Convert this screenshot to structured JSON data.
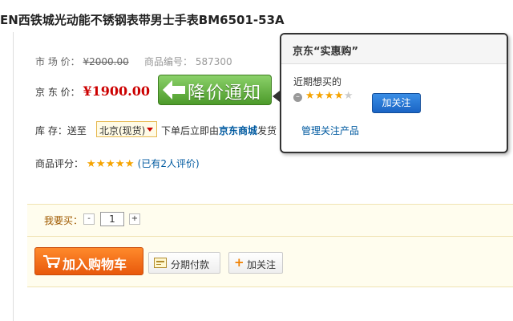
{
  "product": {
    "title": "EN西铁城光动能不锈钢表带男士手表BM6501-53A"
  },
  "market_price": {
    "label": "市 场 价：",
    "value": "¥2000.00"
  },
  "product_code": {
    "label": "商品编号：",
    "value": "587300"
  },
  "jd_price": {
    "label": "京 东 价：",
    "value": "¥1900.00"
  },
  "price_notify_button": "降价通知",
  "stock": {
    "label": "库    存：送至",
    "region": "北京(现货)",
    "note_prefix": "下单后立即由",
    "seller": "京东商城",
    "note_suffix": "发货"
  },
  "rating": {
    "label": "商品评分：",
    "stars": 5,
    "reviews_link": "(已有2人评价)"
  },
  "buy": {
    "want_label": "我要买：",
    "minus": "-",
    "quantity": "1",
    "plus": "+",
    "add_to_cart": "加入购物车",
    "installment": "分期付款",
    "follow": "加关注"
  },
  "popup": {
    "title": "京东“实惠购”",
    "recent_label": "近期想买的",
    "rating_stars": 4,
    "follow_button": "加关注",
    "manage_link": "管理关注产品"
  },
  "colors": {
    "price_red": "#cc0000",
    "link_blue": "#005aa0",
    "notify_green": "#4c9a2a",
    "cart_orange": "#e8590c",
    "star_gold": "#f5a300"
  }
}
